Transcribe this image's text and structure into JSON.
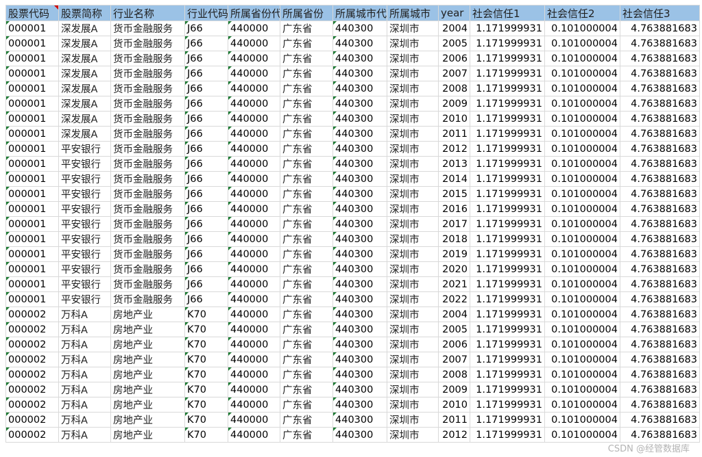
{
  "sheet": {
    "headers": [
      "股票代码",
      "股票简称",
      "行业名称",
      "行业代码",
      "所属省份代码",
      "所属省份",
      "所属城市代码",
      "所属城市",
      "year",
      "社会信任1",
      "社会信任2",
      "社会信任3"
    ],
    "rows": [
      [
        "000001",
        "深发展A",
        "货币金融服务",
        "J66",
        "440000",
        "广东省",
        "440300",
        "深圳市",
        "2004",
        "1.171999931",
        "0.101000004",
        "4.763881683"
      ],
      [
        "000001",
        "深发展A",
        "货币金融服务",
        "J66",
        "440000",
        "广东省",
        "440300",
        "深圳市",
        "2005",
        "1.171999931",
        "0.101000004",
        "4.763881683"
      ],
      [
        "000001",
        "深发展A",
        "货币金融服务",
        "J66",
        "440000",
        "广东省",
        "440300",
        "深圳市",
        "2006",
        "1.171999931",
        "0.101000004",
        "4.763881683"
      ],
      [
        "000001",
        "深发展A",
        "货币金融服务",
        "J66",
        "440000",
        "广东省",
        "440300",
        "深圳市",
        "2007",
        "1.171999931",
        "0.101000004",
        "4.763881683"
      ],
      [
        "000001",
        "深发展A",
        "货币金融服务",
        "J66",
        "440000",
        "广东省",
        "440300",
        "深圳市",
        "2008",
        "1.171999931",
        "0.101000004",
        "4.763881683"
      ],
      [
        "000001",
        "深发展A",
        "货币金融服务",
        "J66",
        "440000",
        "广东省",
        "440300",
        "深圳市",
        "2009",
        "1.171999931",
        "0.101000004",
        "4.763881683"
      ],
      [
        "000001",
        "深发展A",
        "货币金融服务",
        "J66",
        "440000",
        "广东省",
        "440300",
        "深圳市",
        "2010",
        "1.171999931",
        "0.101000004",
        "4.763881683"
      ],
      [
        "000001",
        "深发展A",
        "货币金融服务",
        "J66",
        "440000",
        "广东省",
        "440300",
        "深圳市",
        "2011",
        "1.171999931",
        "0.101000004",
        "4.763881683"
      ],
      [
        "000001",
        "平安银行",
        "货币金融服务",
        "J66",
        "440000",
        "广东省",
        "440300",
        "深圳市",
        "2012",
        "1.171999931",
        "0.101000004",
        "4.763881683"
      ],
      [
        "000001",
        "平安银行",
        "货币金融服务",
        "J66",
        "440000",
        "广东省",
        "440300",
        "深圳市",
        "2013",
        "1.171999931",
        "0.101000004",
        "4.763881683"
      ],
      [
        "000001",
        "平安银行",
        "货币金融服务",
        "J66",
        "440000",
        "广东省",
        "440300",
        "深圳市",
        "2014",
        "1.171999931",
        "0.101000004",
        "4.763881683"
      ],
      [
        "000001",
        "平安银行",
        "货币金融服务",
        "J66",
        "440000",
        "广东省",
        "440300",
        "深圳市",
        "2015",
        "1.171999931",
        "0.101000004",
        "4.763881683"
      ],
      [
        "000001",
        "平安银行",
        "货币金融服务",
        "J66",
        "440000",
        "广东省",
        "440300",
        "深圳市",
        "2016",
        "1.171999931",
        "0.101000004",
        "4.763881683"
      ],
      [
        "000001",
        "平安银行",
        "货币金融服务",
        "J66",
        "440000",
        "广东省",
        "440300",
        "深圳市",
        "2017",
        "1.171999931",
        "0.101000004",
        "4.763881683"
      ],
      [
        "000001",
        "平安银行",
        "货币金融服务",
        "J66",
        "440000",
        "广东省",
        "440300",
        "深圳市",
        "2018",
        "1.171999931",
        "0.101000004",
        "4.763881683"
      ],
      [
        "000001",
        "平安银行",
        "货币金融服务",
        "J66",
        "440000",
        "广东省",
        "440300",
        "深圳市",
        "2019",
        "1.171999931",
        "0.101000004",
        "4.763881683"
      ],
      [
        "000001",
        "平安银行",
        "货币金融服务",
        "J66",
        "440000",
        "广东省",
        "440300",
        "深圳市",
        "2020",
        "1.171999931",
        "0.101000004",
        "4.763881683"
      ],
      [
        "000001",
        "平安银行",
        "货币金融服务",
        "J66",
        "440000",
        "广东省",
        "440300",
        "深圳市",
        "2021",
        "1.171999931",
        "0.101000004",
        "4.763881683"
      ],
      [
        "000001",
        "平安银行",
        "货币金融服务",
        "J66",
        "440000",
        "广东省",
        "440300",
        "深圳市",
        "2022",
        "1.171999931",
        "0.101000004",
        "4.763881683"
      ],
      [
        "000002",
        "万科A",
        "房地产业",
        "K70",
        "440000",
        "广东省",
        "440300",
        "深圳市",
        "2004",
        "1.171999931",
        "0.101000004",
        "4.763881683"
      ],
      [
        "000002",
        "万科A",
        "房地产业",
        "K70",
        "440000",
        "广东省",
        "440300",
        "深圳市",
        "2005",
        "1.171999931",
        "0.101000004",
        "4.763881683"
      ],
      [
        "000002",
        "万科A",
        "房地产业",
        "K70",
        "440000",
        "广东省",
        "440300",
        "深圳市",
        "2006",
        "1.171999931",
        "0.101000004",
        "4.763881683"
      ],
      [
        "000002",
        "万科A",
        "房地产业",
        "K70",
        "440000",
        "广东省",
        "440300",
        "深圳市",
        "2007",
        "1.171999931",
        "0.101000004",
        "4.763881683"
      ],
      [
        "000002",
        "万科A",
        "房地产业",
        "K70",
        "440000",
        "广东省",
        "440300",
        "深圳市",
        "2008",
        "1.171999931",
        "0.101000004",
        "4.763881683"
      ],
      [
        "000002",
        "万科A",
        "房地产业",
        "K70",
        "440000",
        "广东省",
        "440300",
        "深圳市",
        "2009",
        "1.171999931",
        "0.101000004",
        "4.763881683"
      ],
      [
        "000002",
        "万科A",
        "房地产业",
        "K70",
        "440000",
        "广东省",
        "440300",
        "深圳市",
        "2010",
        "1.171999931",
        "0.101000004",
        "4.763881683"
      ],
      [
        "000002",
        "万科A",
        "房地产业",
        "K70",
        "440000",
        "广东省",
        "440300",
        "深圳市",
        "2011",
        "1.171999931",
        "0.101000004",
        "4.763881683"
      ],
      [
        "000002",
        "万科A",
        "房地产业",
        "K70",
        "440000",
        "广东省",
        "440300",
        "深圳市",
        "2012",
        "1.171999931",
        "0.101000004",
        "4.763881683"
      ]
    ]
  },
  "watermark": "CSDN @经管数据库",
  "colors": {
    "header_bg": "#9bc2e6",
    "gridline": "#d9d9d9",
    "text_number_marker": "#1e7b34",
    "comment_marker": "#d00000"
  }
}
